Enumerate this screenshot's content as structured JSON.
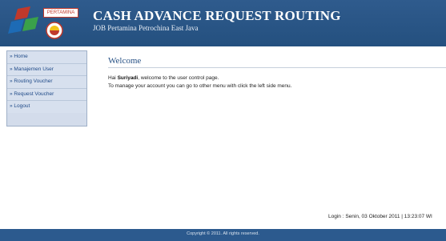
{
  "header": {
    "logo_text": "PERTAMINA",
    "title": "CASH ADVANCE REQUEST ROUTING",
    "subtitle": "JOB Pertamina Petrochina East Java"
  },
  "sidebar": {
    "items": [
      {
        "label": "» Home"
      },
      {
        "label": "» Manajemen User"
      },
      {
        "label": "» Routing Voucher"
      },
      {
        "label": "» Request Voucher"
      },
      {
        "label": "» Logout"
      }
    ]
  },
  "main": {
    "title": "Welcome",
    "greeting_prefix": "Hai ",
    "user_name": "Suriyadi",
    "greeting_suffix": ", welcome to the user control page.",
    "instruction": "To manage your account you can go to other menu with click the left side menu.",
    "login_info": "Login : Senin, 03 Oktober 2011 | 13:23:07 WI"
  },
  "footer": {
    "copyright": "Copyright © 2011. All rights reserved."
  },
  "colors": {
    "header_bg": "#2f5b8d",
    "menu_text": "#1f4a88",
    "title_color": "#275185"
  }
}
